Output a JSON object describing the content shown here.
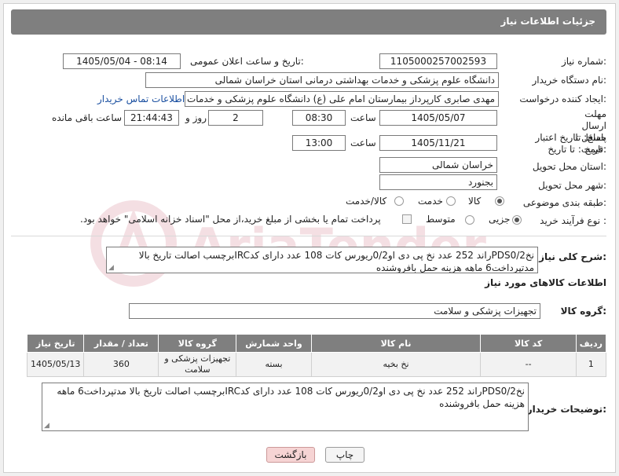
{
  "header": {
    "title": "جزئیات اطلاعات نیاز"
  },
  "fields": {
    "need_number_label": "شماره نیاز:",
    "need_number": "1105000257002593",
    "announce_label": "تاریخ و ساعت اعلان عمومی:",
    "announce_value": "1405/05/04 - 08:14",
    "buyer_org_label": "نام دستگاه خریدار:",
    "buyer_org": "دانشگاه علوم پزشکی و خدمات بهداشتی درمانی استان خراسان شمالی",
    "requester_label": "ایجاد کننده درخواست:",
    "requester": "مهدی صابری کارپرداز بیمارستان امام علی (ع) دانشگاه علوم پزشکی و خدمات بهداشتی",
    "contact_link": "اطلاعات تماس خریدار",
    "deadline_label": "مهلت ارسال پاسخ: تا تاریخ:",
    "deadline_date": "1405/05/07",
    "time_label": "ساعت",
    "deadline_time": "08:30",
    "days_value": "2",
    "days_label": "روز و",
    "remaining_time": "21:44:43",
    "remaining_label": "ساعت باقی مانده",
    "validity_label": "حداقل تاریخ اعتبار قیمت: تا تاریخ:",
    "validity_date": "1405/11/21",
    "validity_time": "13:00",
    "province_label": "استان محل تحویل:",
    "province": "خراسان شمالی",
    "city_label": "شهر محل تحویل:",
    "city": "بجنورد",
    "category_label": "طبقه بندی موضوعی:",
    "category_options": [
      "کالا",
      "خدمت",
      "کالا/خدمت"
    ],
    "process_label": "نوع فرآیند خرید :",
    "process_options": [
      "جزیی",
      "متوسط"
    ],
    "payment_note": "پرداخت تمام یا بخشی از مبلغ خرید،از محل \"اسناد خزانه اسلامی\" خواهد بود."
  },
  "description": {
    "label": "شرح کلی نیاز:",
    "text": "نخPDS0/2راند 252 عدد نخ پی دی او0/2ریورس کات 108 عدد دارای کدIRCبرچسب اصالت تاریخ بالا مدتپرداخت6 ماهه هزینه حمل بافروشنده"
  },
  "goods": {
    "section_title": "اطلاعات کالاهای مورد نیاز",
    "group_label": "گروه کالا:",
    "group_value": "تجهیزات پزشکی و سلامت",
    "columns": [
      "ردیف",
      "کد کالا",
      "نام کالا",
      "واحد شمارش",
      "گروه کالا",
      "تعداد / مقدار",
      "تاریخ نیاز"
    ],
    "rows": [
      {
        "row": "1",
        "code": "--",
        "name": "نخ بخیه",
        "unit": "بسته",
        "group": "تجهیزات پزشکی و سلامت",
        "qty": "360",
        "date": "1405/05/13"
      }
    ]
  },
  "buyer_notes": {
    "label": "توضیحات خریدار:",
    "text": "نخPDS0/2راند 252 عدد نخ پی دی او0/2ریورس کات 108 عدد دارای کدIRCبرچسب اصالت تاریخ بالا مدتپرداخت6 ماهه هزینه حمل بافروشنده"
  },
  "buttons": {
    "print": "چاپ",
    "back": "بازگشت"
  },
  "watermark": {
    "text": "AriaTender.net"
  }
}
